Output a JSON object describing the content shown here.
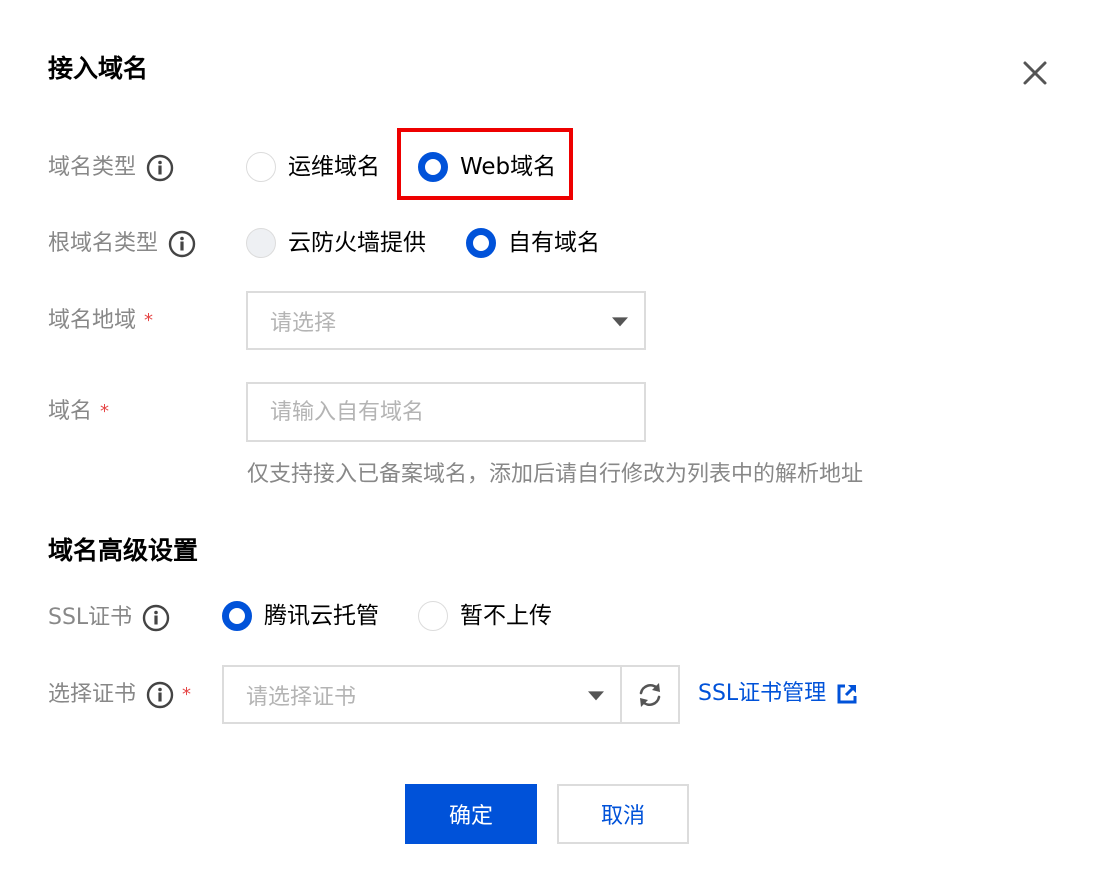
{
  "dialog": {
    "title": "接入域名",
    "close_icon": "close-icon"
  },
  "domain_type": {
    "label": "域名类型",
    "options": [
      {
        "label": "运维域名",
        "checked": false
      },
      {
        "label": "Web域名",
        "checked": true
      }
    ]
  },
  "root_domain_type": {
    "label": "根域名类型",
    "options": [
      {
        "label": "云防火墙提供",
        "checked": false,
        "disabled": true
      },
      {
        "label": "自有域名",
        "checked": true
      }
    ]
  },
  "domain_region": {
    "label": "域名地域",
    "required_mark": "*",
    "placeholder": "请选择"
  },
  "domain": {
    "label": "域名",
    "required_mark": "*",
    "placeholder": "请输入自有域名",
    "hint": "仅支持接入已备案域名，添加后请自行修改为列表中的解析地址"
  },
  "advanced": {
    "title": "域名高级设置",
    "ssl": {
      "label": "SSL证书",
      "options": [
        {
          "label": "腾讯云托管",
          "checked": true
        },
        {
          "label": "暂不上传",
          "checked": false
        }
      ]
    },
    "cert": {
      "label": "选择证书",
      "required_mark": "*",
      "placeholder": "请选择证书",
      "link_label": "SSL证书管理"
    }
  },
  "footer": {
    "confirm_label": "确定",
    "cancel_label": "取消"
  },
  "colors": {
    "primary": "#0052d9",
    "required": "#e54545",
    "highlight": "#ee0000"
  }
}
